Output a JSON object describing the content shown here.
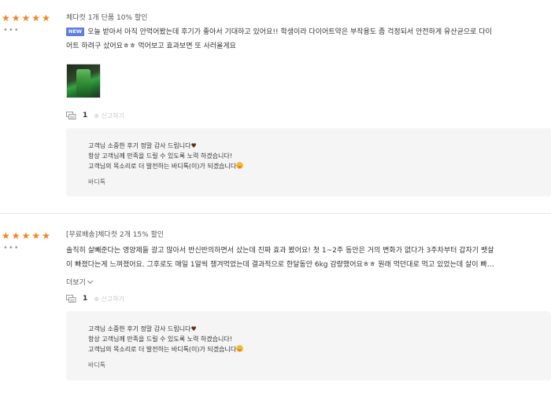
{
  "reviews": [
    {
      "stars": [
        "★",
        "★",
        "★",
        "★",
        "★"
      ],
      "more": "•••",
      "option": "체다컷 1개 단품 10% 할인",
      "badge": "NEW",
      "text_line1": "오늘 받아서 아직 안먹어봤는데 후기가 좋아서 기대하고 있어요!! 학생이라 다이어트약은 부작용도 좀 걱정되서 안전하게 유산균으로 다이",
      "text_line2": "어트 하려구 샀어요ㅎㅎ 먹어보고 효과보면 또 사러올게요",
      "comment_count": "1",
      "report": "⊕ 신고하기",
      "reply": {
        "line1": "고객님 소중한 후기 정말 감사 드립니다",
        "heart": "♥",
        "line2": "항상 고객님께 만족을 드릴 수 있도록 노력 하겠습니다!",
        "line3": "고객님의 목소리로 더 발전하는 바디톡(이)가 되겠습니다",
        "author": "바디톡"
      }
    },
    {
      "stars": [
        "★",
        "★",
        "★",
        "★",
        "★"
      ],
      "more": "•••",
      "option": "[무료배송]체다컷 2개 15% 할인",
      "text_line1": "솔직히 살빼준다는 영양제들 광고 많아서 반신반의하면서 샀는데 진짜 효과 봤어요! 첫 1~2주 동안은 거의 변화가 없다가 3주차부터 갑자기 뱃살",
      "text_line2": "이 빠졌다는게 느껴졌어요. 그후로도 매일 1알씩 챙겨먹었는데 결과적으로 한달동안 6kg 감량했어요ㅎㅎ 원래 먹던대로 먹고 있었는데 살이 빠…",
      "more_label": "더보기",
      "comment_count": "1",
      "report": "⊕ 신고하기",
      "reply": {
        "line1": "고객님 소중한 후기 정말 감사 드립니다",
        "heart": "♥",
        "line2": "항상 고객님께 만족을 드릴 수 있도록 노력 하겠습니다!",
        "line3": "고객님의 목소리로 더 발전하는 바디톡(이)가 되겠습니다",
        "author": "바디톡"
      }
    }
  ],
  "colors": {
    "star": "#f5821f",
    "badge": "#5b7de8",
    "reply_bg": "#f5f5f5"
  }
}
